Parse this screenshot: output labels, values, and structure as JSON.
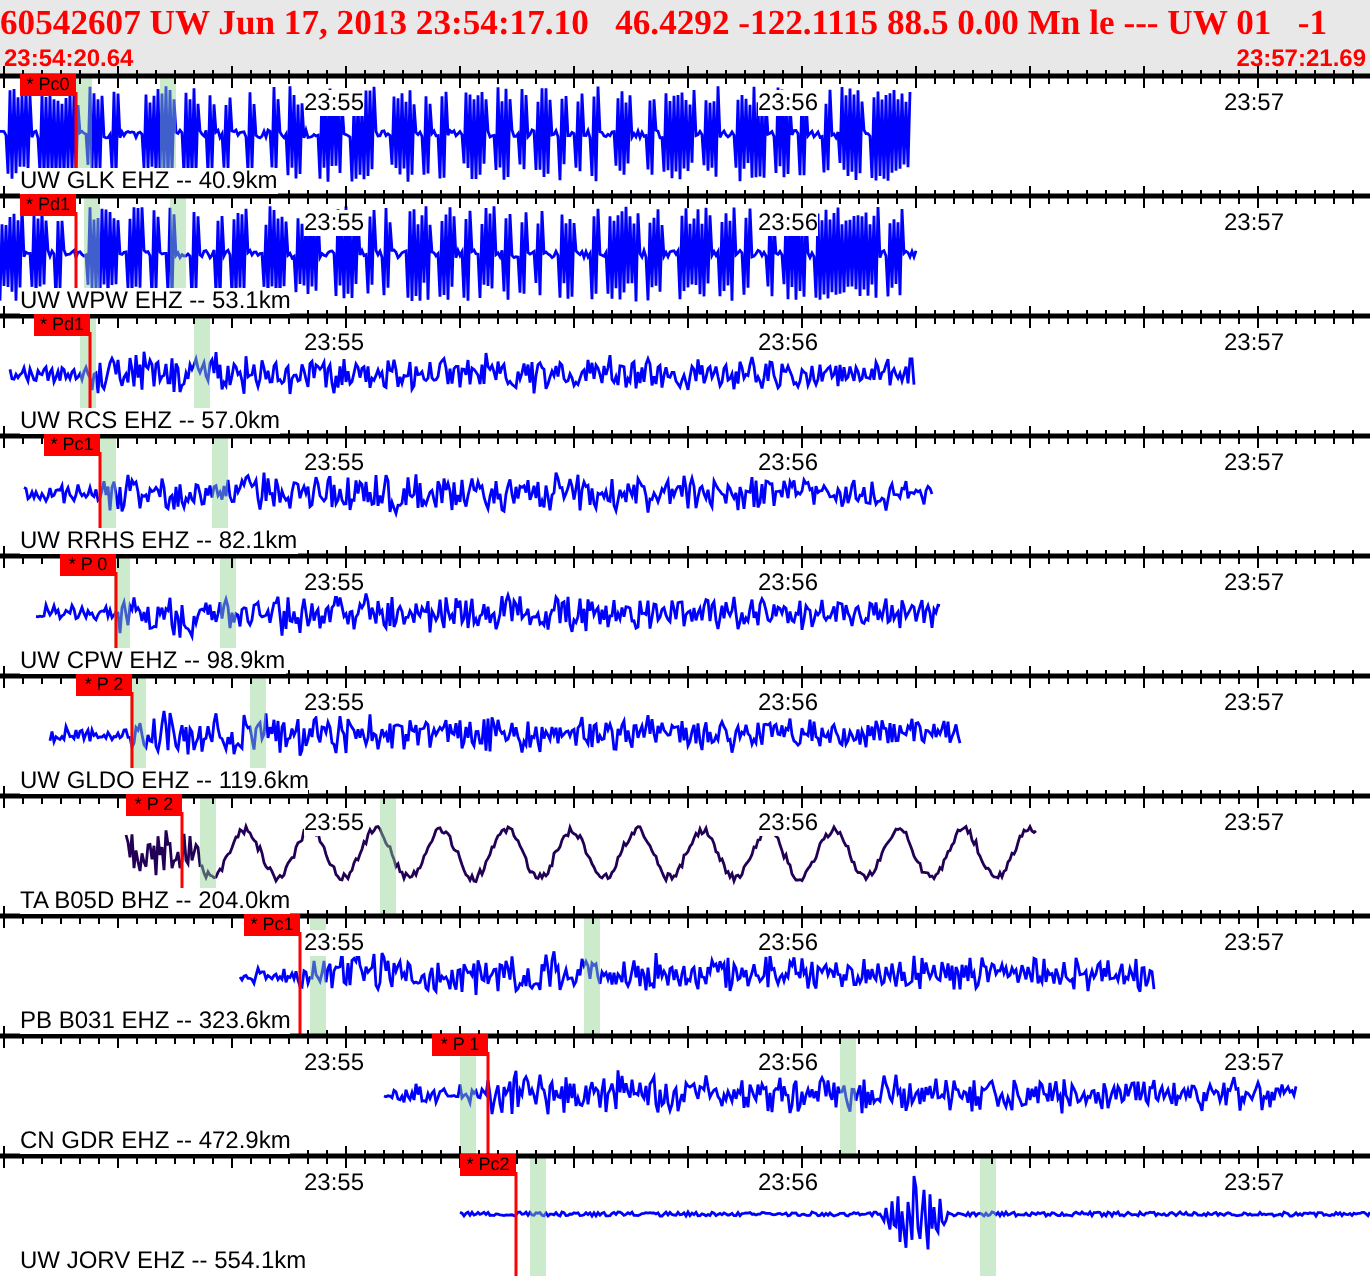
{
  "header": {
    "title": "60542607 UW Jun 17, 2013 23:54:17.10   46.4292 -122.1115 88.5 0.00 Mn le --- UW 01   -1",
    "start_time": "23:54:20.64",
    "end_time": "23:57:21.69"
  },
  "traces": [
    {
      "station": "UW GLK EHZ -- 40.9km",
      "pick": "* Pc0",
      "kind": "clipped",
      "color": "#0000ff",
      "ticks": [
        "23:55",
        "23:56",
        "23:57"
      ]
    },
    {
      "station": "UW WPW EHZ -- 53.1km",
      "pick": "* Pd1",
      "kind": "clipped",
      "color": "#0000ff",
      "ticks": [
        "23:55",
        "23:56",
        "23:57"
      ]
    },
    {
      "station": "UW RCS EHZ -- 57.0km",
      "pick": "* Pd1",
      "kind": "noise",
      "color": "#0000ff",
      "ticks": [
        "23:55",
        "23:56",
        "23:57"
      ]
    },
    {
      "station": "UW RRHS EHZ -- 82.1km",
      "pick": "* Pc1",
      "kind": "noise",
      "color": "#0000ff",
      "ticks": [
        "23:55",
        "23:56",
        "23:57"
      ]
    },
    {
      "station": "UW CPW EHZ -- 98.9km",
      "pick": "* P 0",
      "kind": "noise",
      "color": "#0000ff",
      "ticks": [
        "23:55",
        "23:56",
        "23:57"
      ]
    },
    {
      "station": "UW GLDO EHZ -- 119.6km",
      "pick": "* P 2",
      "kind": "noise",
      "color": "#0000ff",
      "ticks": [
        "23:55",
        "23:56",
        "23:57"
      ]
    },
    {
      "station": "TA B05D BHZ -- 204.0km",
      "pick": "* P 2",
      "kind": "longperiod",
      "color": "#220055",
      "ticks": [
        "23:55",
        "23:56",
        "23:57"
      ]
    },
    {
      "station": "PB B031 EHZ -- 323.6km",
      "pick": "* Pc1",
      "kind": "noise",
      "color": "#0000ff",
      "ticks": [
        "23:55",
        "23:56",
        "23:57"
      ]
    },
    {
      "station": "CN GDR EHZ -- 472.9km",
      "pick": "* P 1",
      "kind": "noise",
      "color": "#0000ff",
      "ticks": [
        "23:55",
        "23:56",
        "23:57"
      ]
    },
    {
      "station": "UW JORV EHZ -- 554.1km",
      "pick": "* Pc2",
      "kind": "burst",
      "color": "#0000ff",
      "ticks": [
        "23:55",
        "23:56",
        "23:57"
      ]
    }
  ]
}
